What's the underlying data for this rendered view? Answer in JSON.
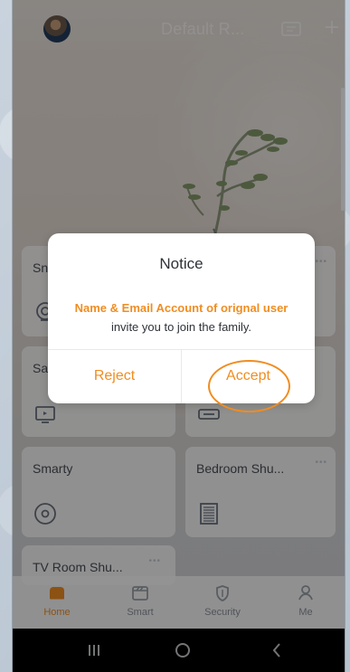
{
  "header": {
    "title": "Default R..."
  },
  "devices": [
    {
      "name": "Sn",
      "icon": "camera-icon"
    },
    {
      "name": "Sa",
      "icon": "tv-icon"
    },
    {
      "name": "",
      "icon": "tv-box-icon"
    },
    {
      "name": "Smarty",
      "icon": "speaker-icon"
    },
    {
      "name": "Bedroom Shu...",
      "icon": "shutter-icon"
    },
    {
      "name": "TV Room Shu...",
      "icon": "shutter-icon"
    }
  ],
  "dialog": {
    "title": "Notice",
    "highlight": "Name & Email Account of orignal user",
    "message_rest": "invite you to join the family.",
    "reject_label": "Reject",
    "accept_label": "Accept"
  },
  "bottom_nav": [
    {
      "label": "Home",
      "icon": "home-icon"
    },
    {
      "label": "Smart",
      "icon": "smart-icon"
    },
    {
      "label": "Security",
      "icon": "security-icon"
    },
    {
      "label": "Me",
      "icon": "profile-icon"
    }
  ],
  "colors": {
    "accent": "#f08d21",
    "dialog_text": "#2f3339",
    "overlay": "#000000"
  },
  "android_nav": {
    "recent_icon": "recent-apps-icon",
    "home_icon": "android-home-icon",
    "back_icon": "back-icon"
  }
}
